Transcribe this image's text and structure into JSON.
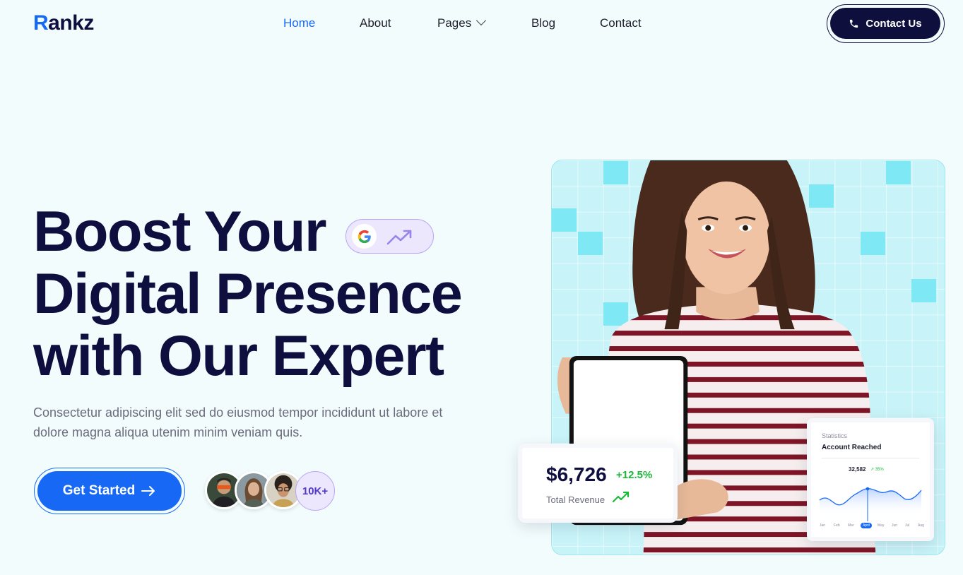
{
  "brand": {
    "first": "R",
    "rest": "ankz"
  },
  "nav": {
    "items": [
      {
        "label": "Home",
        "active": true
      },
      {
        "label": "About",
        "active": false
      },
      {
        "label": "Pages",
        "active": false,
        "has_dropdown": true
      },
      {
        "label": "Blog",
        "active": false
      },
      {
        "label": "Contact",
        "active": false
      }
    ]
  },
  "header_cta": {
    "label": "Contact Us",
    "icon": "phone-icon"
  },
  "hero": {
    "title_lines": [
      "Boost Your",
      "Digital Presence",
      "with Our Expert"
    ],
    "badge": {
      "google_letter": "G",
      "icon": "trend-up-icon"
    },
    "description": "Consectetur adipiscing elit sed do eiusmod tempor incididunt ut labore et dolore magna aliqua utenim minim veniam quis.",
    "cta_label": "Get Started",
    "social_count": "10K+"
  },
  "revenue_card": {
    "value": "$6,726",
    "change": "+12.5%",
    "label": "Total Revenue"
  },
  "stats_card": {
    "title": "Statistics",
    "subtitle": "Account Reached",
    "value": "32,582",
    "change": "35%",
    "months": [
      "Jan",
      "Feb",
      "Mar",
      "April",
      "May",
      "Jun",
      "Jul",
      "Aug"
    ],
    "selected_month": "April"
  },
  "colors": {
    "primary": "#1769f5",
    "navy": "#0e0f3f",
    "background": "#f3fcfd",
    "accent_purple": "#ece7fd",
    "success": "#1bb93a"
  }
}
